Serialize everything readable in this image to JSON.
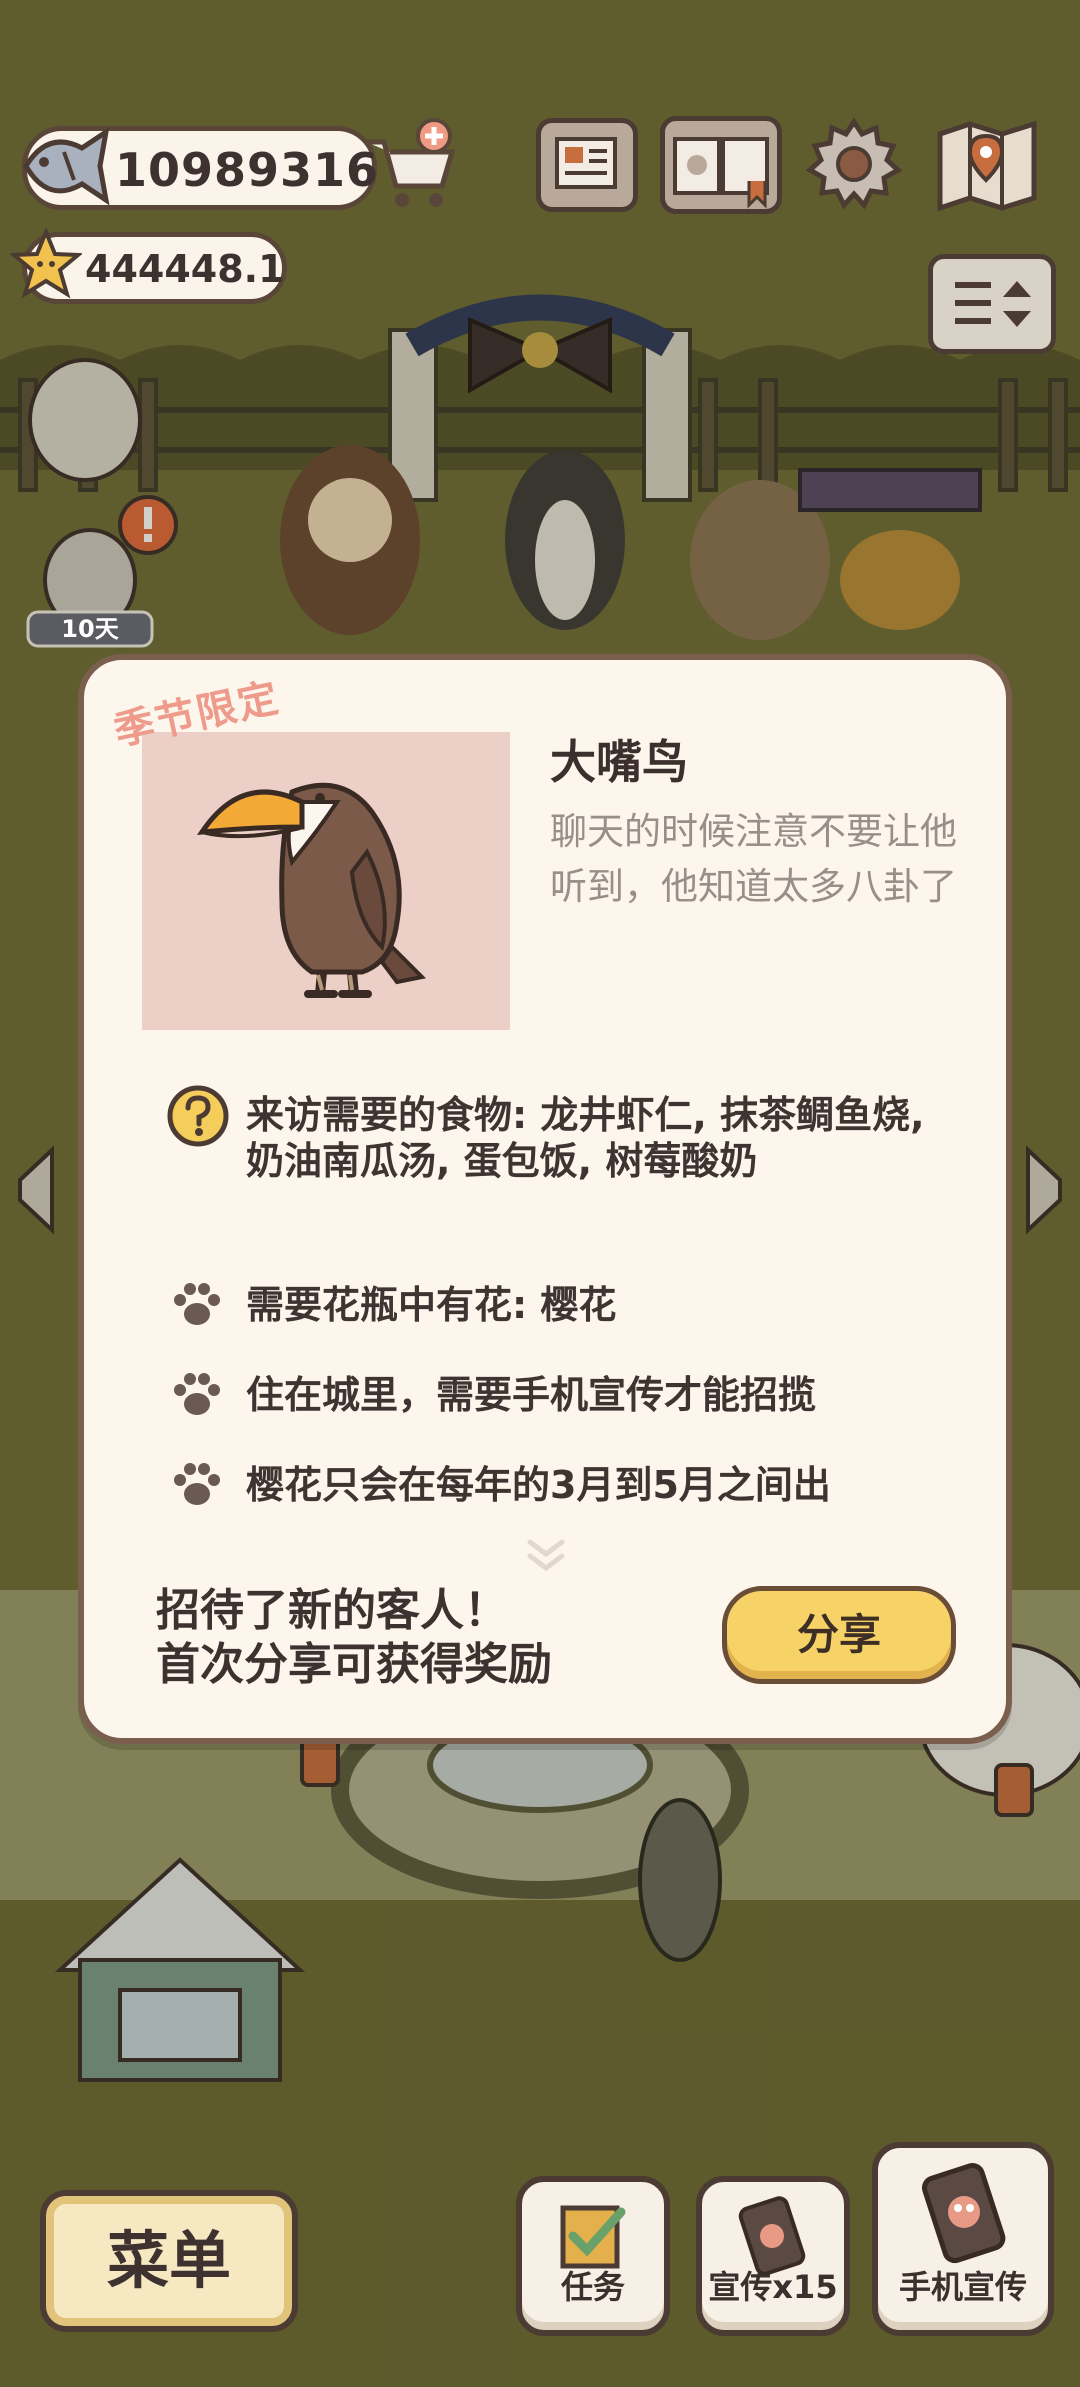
{
  "hud": {
    "fish_count": "10989316",
    "star_count": "444448.1",
    "days_badge": "10天"
  },
  "modal": {
    "limited_tag": "季节限定",
    "title": "大嘴鸟",
    "description": "聊天的时候注意不要让他听到，他知道太多八卦了",
    "requirements": [
      {
        "icon": "question-icon",
        "text": "来访需要的食物: 龙井虾仁, 抹茶鲷鱼烧, 奶油南瓜汤, 蛋包饭, 树莓酸奶"
      },
      {
        "icon": "paw-icon",
        "text": "需要花瓶中有花: 樱花"
      },
      {
        "icon": "paw-icon",
        "text": "住在城里，需要手机宣传才能招揽"
      },
      {
        "icon": "paw-icon",
        "text": "樱花只会在每年的3月到5月之间出"
      }
    ],
    "new_guest_line1": "招待了新的客人！",
    "new_guest_line2": "首次分享可获得奖励",
    "share_label": "分享"
  },
  "bottom": {
    "menu_label": "菜单",
    "tasks_label": "任务",
    "promo_label": "宣传x15",
    "phone_promo_label": "手机宣传"
  },
  "colors": {
    "modal_bg": "#fcf6ec",
    "modal_border": "#7a5e4e",
    "share_button": "#f7d267",
    "portrait_bg": "#eccfc6",
    "limited_tag": "#ee9b8c"
  }
}
